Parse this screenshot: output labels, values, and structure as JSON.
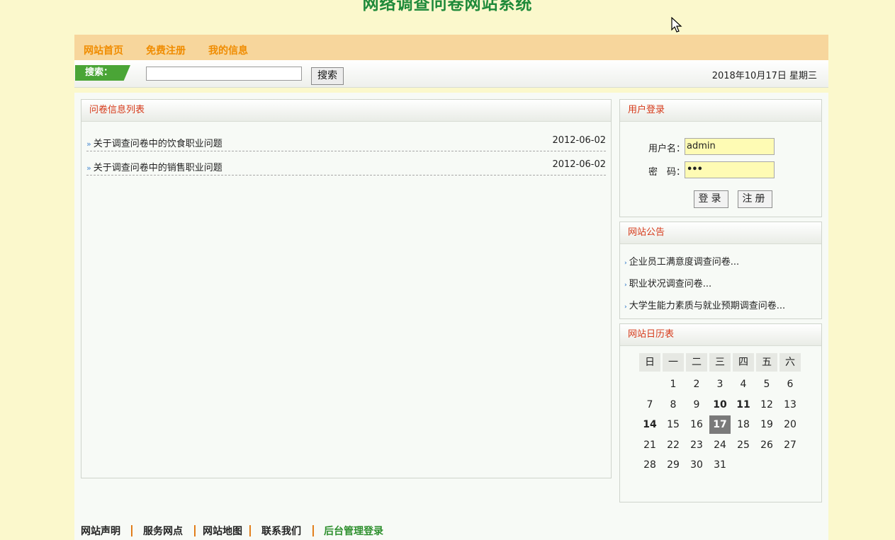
{
  "site_title": "网络调查问卷网站系统",
  "nav": [
    "网站首页",
    "免费注册",
    "我的信息"
  ],
  "search": {
    "tag_label": "搜索：",
    "input_value": "",
    "button_label": "搜索"
  },
  "date_text": "2018年10月17日 星期三",
  "survey_list": {
    "title": "问卷信息列表",
    "items": [
      {
        "title": "关于调查问卷中的饮食职业问题",
        "date": "2012-06-02"
      },
      {
        "title": "关于调查问卷中的销售职业问题",
        "date": "2012-06-02"
      }
    ]
  },
  "login": {
    "title": "用户登录",
    "username_label": "用户名：",
    "username_value": "admin",
    "password_label": "密　码：",
    "password_value": "•••",
    "login_button": "登录",
    "register_button": "注册"
  },
  "notices": {
    "title": "网站公告",
    "items": [
      "企业员工满意度调查问卷...",
      "职业状况调查问卷...",
      "大学生能力素质与就业预期调查问卷..."
    ]
  },
  "calendar": {
    "title": "网站日历表",
    "weekdays": [
      "日",
      "一",
      "二",
      "三",
      "四",
      "五",
      "六"
    ],
    "weeks": [
      [
        "",
        "1",
        "2",
        "3",
        "4",
        "5",
        "6"
      ],
      [
        "7",
        "8",
        "9",
        "10",
        "11",
        "12",
        "13"
      ],
      [
        "14",
        "15",
        "16",
        "17",
        "18",
        "19",
        "20"
      ],
      [
        "21",
        "22",
        "23",
        "24",
        "25",
        "26",
        "27"
      ],
      [
        "28",
        "29",
        "30",
        "31",
        "",
        "",
        ""
      ]
    ],
    "bold_days": [
      "10",
      "11",
      "14"
    ],
    "today": "17"
  },
  "footer": [
    "网站声明",
    "服务网点",
    "网站地图",
    "联系我们",
    "后台管理登录"
  ],
  "colors": {
    "accent_green": "#1f8a3a",
    "nav_orange": "#f08c00",
    "panel_title_red": "#d63a1a"
  }
}
